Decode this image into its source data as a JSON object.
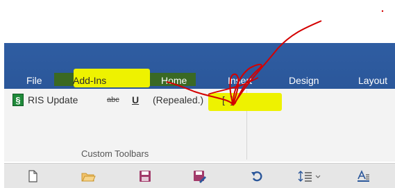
{
  "tabs": {
    "file": "File",
    "addins": "Add-Ins",
    "home": "Home",
    "insert": "Insert",
    "design": "Design",
    "layout": "Layout"
  },
  "ribbon": {
    "s_icon": "§",
    "ris_update": "RIS Update",
    "abc": "abc",
    "underline": "U",
    "repealed": "(Repealed.)",
    "brackets": "[ ]",
    "group_caption": "Custom Toolbars"
  },
  "qat": {
    "items": [
      "new-doc-icon",
      "open-folder-icon",
      "save-icon",
      "save-as-icon",
      "undo-icon",
      "line-spacing-icon",
      "font-color-icon"
    ]
  },
  "colors": {
    "ribbon_blue": "#2b579a",
    "highlight_yellow": "#eef200",
    "highlight_green": "#3c6a1a",
    "scribble_red": "#d40000"
  }
}
